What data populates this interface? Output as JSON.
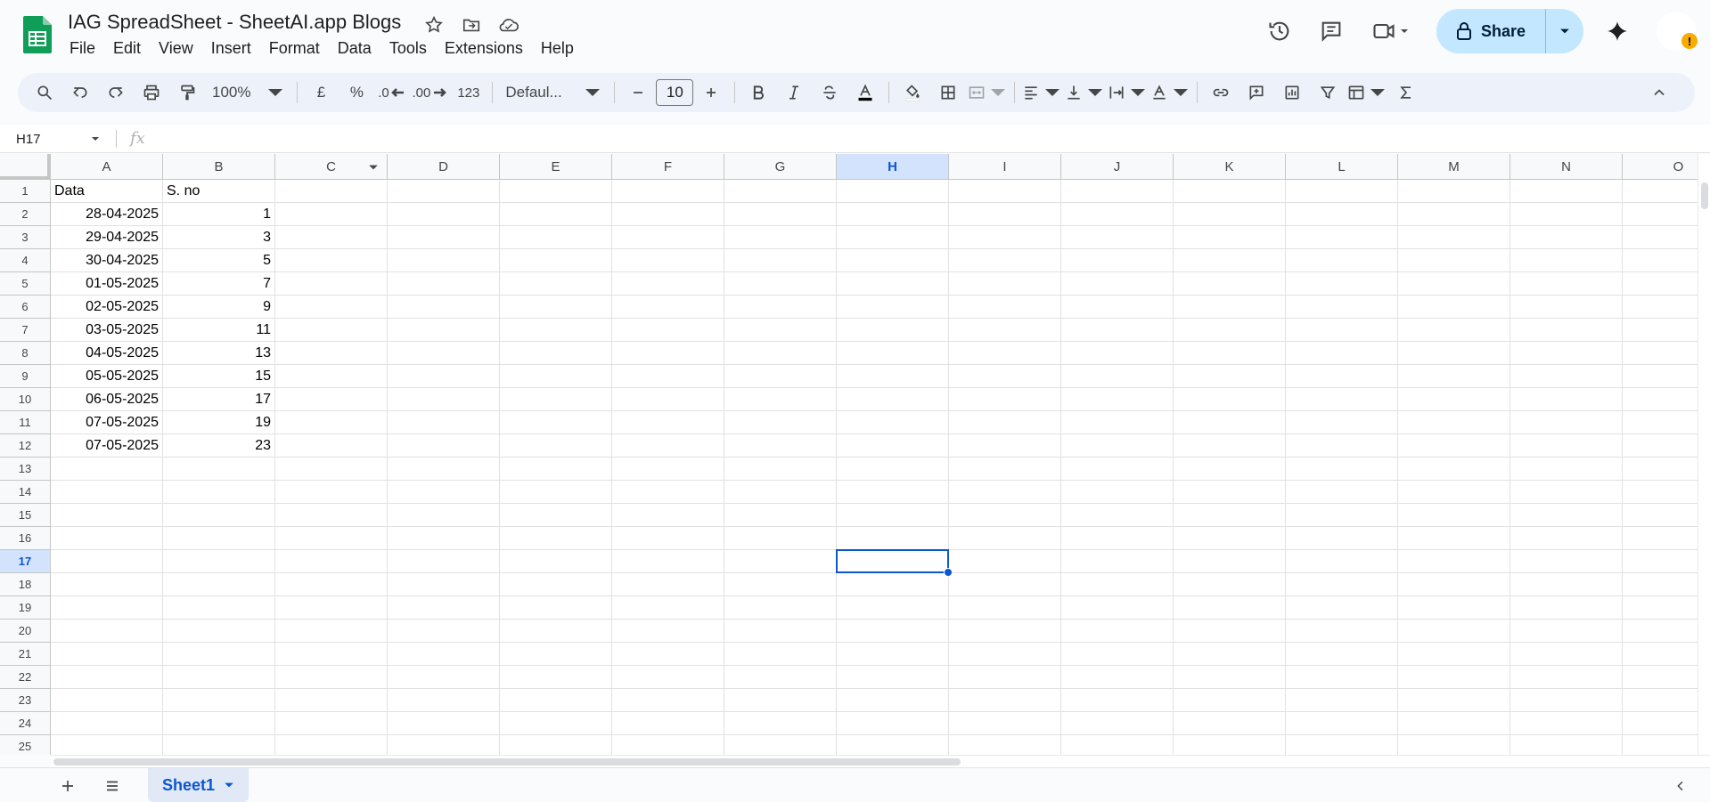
{
  "doc": {
    "title": "IAG SpreadSheet - SheetAI.app Blogs"
  },
  "menu": [
    "File",
    "Edit",
    "View",
    "Insert",
    "Format",
    "Data",
    "Tools",
    "Extensions",
    "Help"
  ],
  "share": {
    "label": "Share"
  },
  "toolbar": {
    "zoom": "100%",
    "currency": "£",
    "percent": "%",
    "decrease_decimal": ".0",
    "increase_decimal": ".00",
    "number_format": "123",
    "font": "Defaul...",
    "font_size": "10"
  },
  "formula_bar": {
    "cell_ref": "H17",
    "fx_label": "fx",
    "content": ""
  },
  "columns": [
    "A",
    "B",
    "C",
    "D",
    "E",
    "F",
    "G",
    "H",
    "I",
    "J",
    "K",
    "L",
    "M",
    "N",
    "O"
  ],
  "selected_column": "H",
  "rows": [
    "1",
    "2",
    "3",
    "4",
    "5",
    "6",
    "7",
    "8",
    "9",
    "10",
    "11",
    "12",
    "13",
    "14",
    "15",
    "16",
    "17",
    "18",
    "19",
    "20",
    "21",
    "22",
    "23",
    "24",
    "25"
  ],
  "selected_row": "17",
  "cells": {
    "A1": "Data",
    "B1": "S. no",
    "data_rows": [
      {
        "date": "28-04-2025",
        "sno": "1"
      },
      {
        "date": "29-04-2025",
        "sno": "3"
      },
      {
        "date": "30-04-2025",
        "sno": "5"
      },
      {
        "date": "01-05-2025",
        "sno": "7"
      },
      {
        "date": "02-05-2025",
        "sno": "9"
      },
      {
        "date": "03-05-2025",
        "sno": "11"
      },
      {
        "date": "04-05-2025",
        "sno": "13"
      },
      {
        "date": "05-05-2025",
        "sno": "15"
      },
      {
        "date": "06-05-2025",
        "sno": "17"
      },
      {
        "date": "07-05-2025",
        "sno": "19"
      },
      {
        "date": "07-05-2025",
        "sno": "23"
      }
    ]
  },
  "sheets": [
    {
      "name": "Sheet1",
      "active": true
    }
  ],
  "colors": {
    "accent": "#0b57d0",
    "share_bg": "#c2e7ff",
    "logo_green": "#0f9d58",
    "warning": "#f9ab00"
  }
}
